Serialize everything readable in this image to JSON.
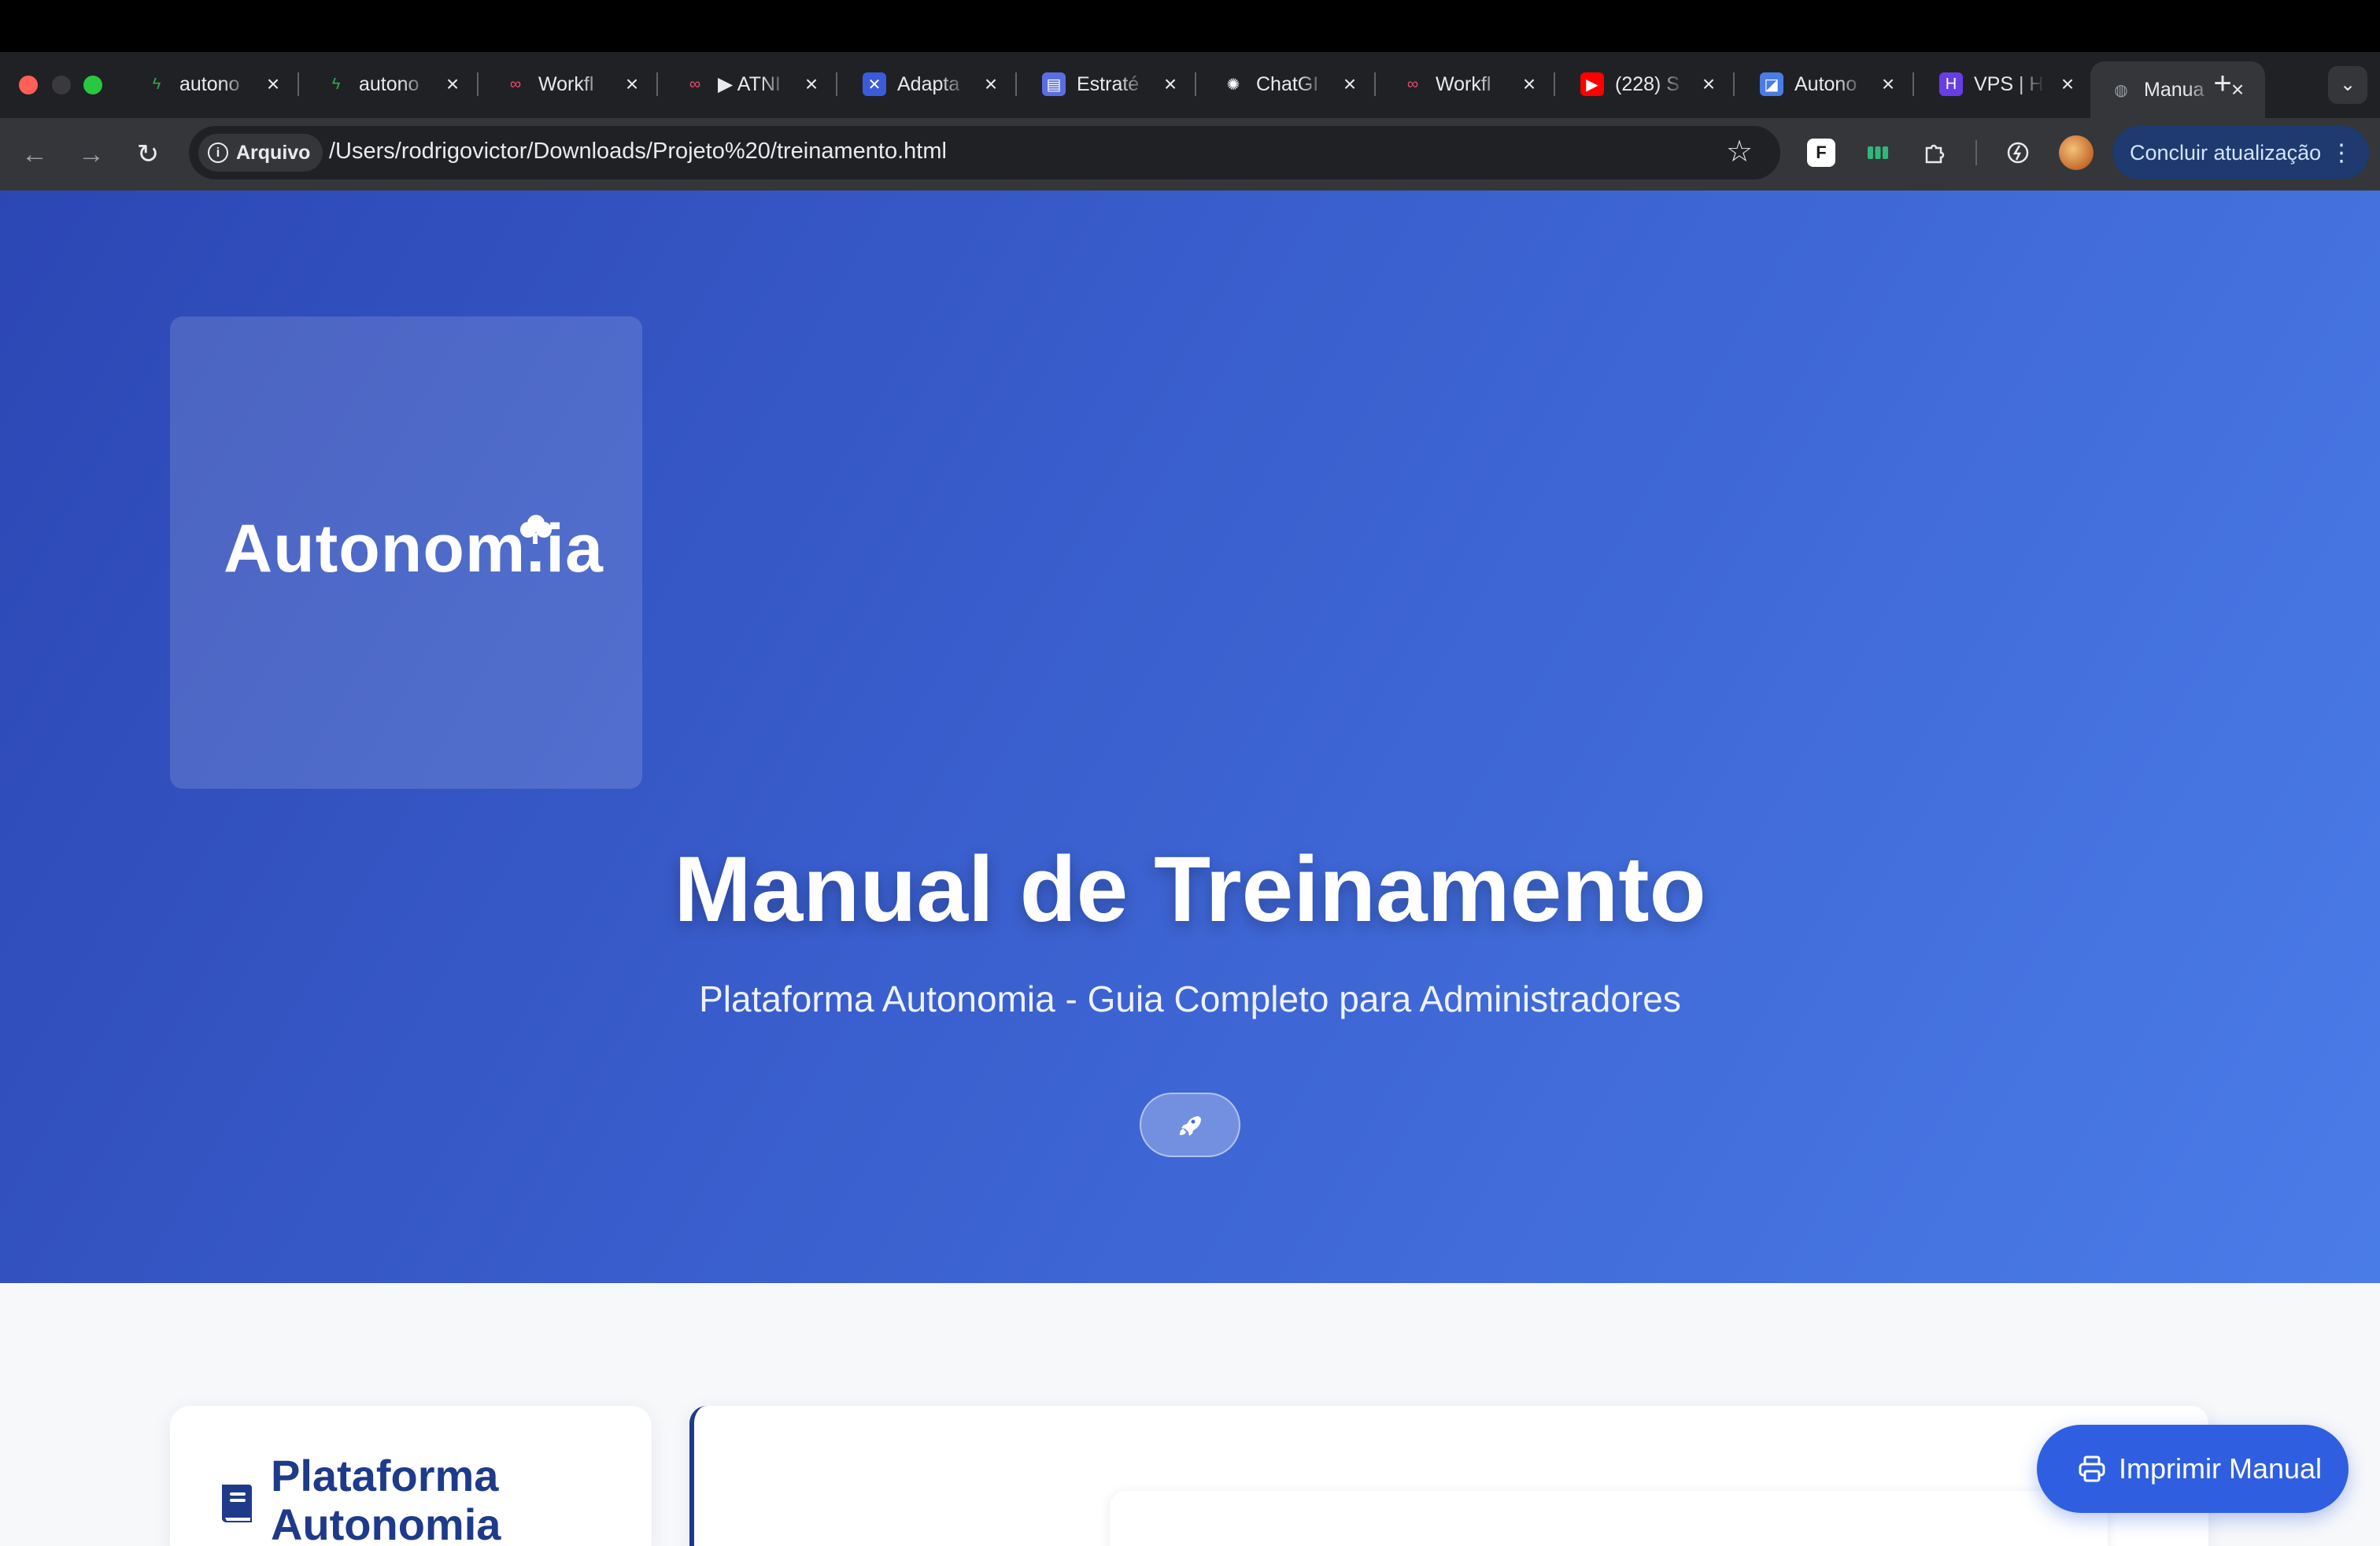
{
  "browser": {
    "tabs": [
      {
        "title": "autono",
        "favicon": "bolt-icon",
        "color": "#34a853"
      },
      {
        "title": "autono",
        "favicon": "bolt-icon",
        "color": "#34a853"
      },
      {
        "title": "Workfl",
        "favicon": "n8n-icon",
        "color": "#ea4b71"
      },
      {
        "title": "▶ ATNI",
        "favicon": "n8n-icon",
        "color": "#ea4b71"
      },
      {
        "title": "Adapta",
        "favicon": "adapta-icon",
        "color": "#3b5bdb"
      },
      {
        "title": "Estraté",
        "favicon": "doc-icon",
        "color": "#5b6ee1"
      },
      {
        "title": "ChatGI",
        "favicon": "openai-icon",
        "color": "#202124"
      },
      {
        "title": "Workfl",
        "favicon": "n8n-icon",
        "color": "#ea4b71"
      },
      {
        "title": "(228) S",
        "favicon": "youtube-icon",
        "color": "#ff0000"
      },
      {
        "title": "Autono",
        "favicon": "app-icon",
        "color": "#4a7ce8"
      },
      {
        "title": "VPS | H",
        "favicon": "hostinger-icon",
        "color": "#673de6"
      },
      {
        "title": "Manua",
        "favicon": "globe-icon",
        "color": "#9aa0a6",
        "active": true
      }
    ],
    "site_chip": "Arquivo",
    "url": "/Users/rodrigovictor/Downloads/Projeto%20/treinamento.html",
    "update_button": "Concluir atualização"
  },
  "hero": {
    "logo": "Autonom.ia",
    "title": "Manual de Treinamento",
    "subtitle": "Plataforma Autonomia - Guia Completo para Administradores",
    "badge_icon": "rocket-icon"
  },
  "sidebar": {
    "title": "Plataforma Autonomia",
    "icon": "book-icon"
  },
  "print_button": {
    "label": "Imprimir Manual",
    "icon": "printer-icon"
  },
  "colors": {
    "accent": "#2f5fe0",
    "heading": "#1e3a8a",
    "hero_start": "#2c47b4",
    "hero_end": "#4a7ce8"
  }
}
